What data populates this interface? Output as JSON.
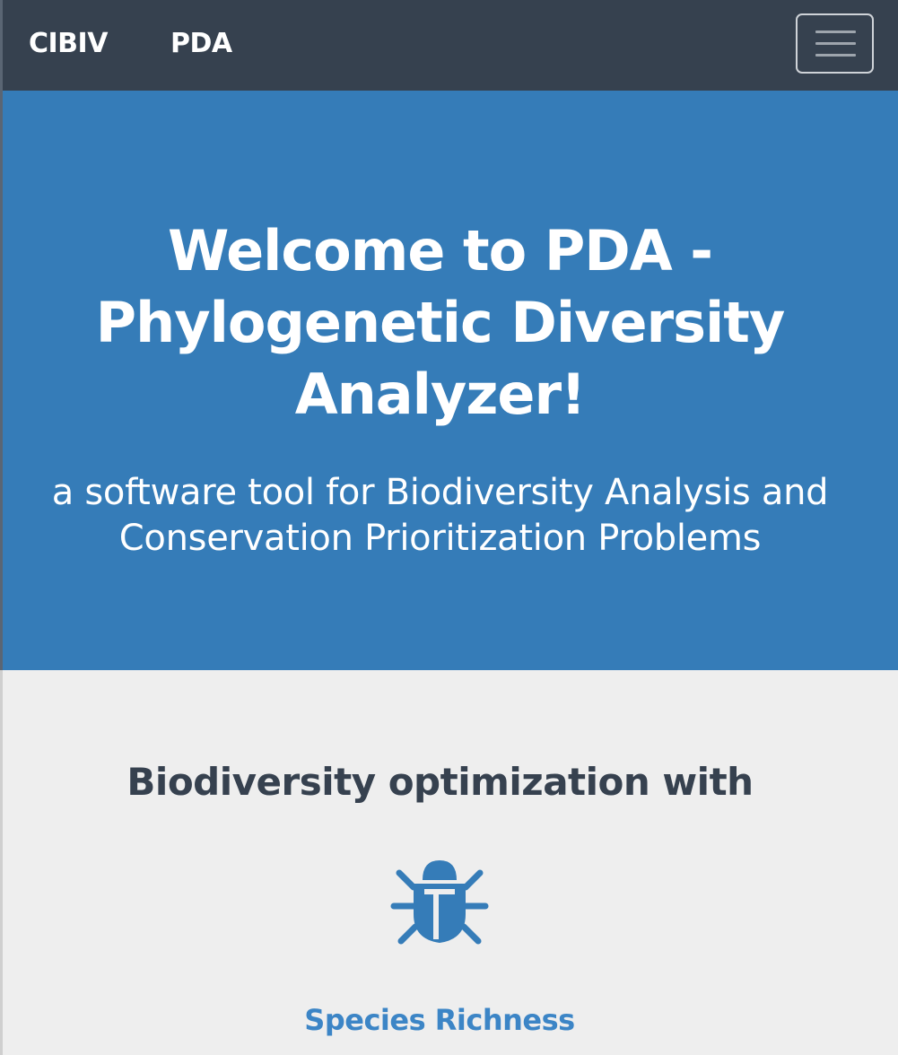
{
  "navbar": {
    "brand_primary": "CIBIV",
    "brand_secondary": "PDA",
    "toggle_icon": "hamburger-menu-icon",
    "background_color": "#36414f"
  },
  "hero": {
    "title": "Welcome to PDA - Phylogenetic Diversity Analyzer!",
    "subtitle": "a software tool for Biodiversity Analysis and Conservation Prioritization Problems",
    "background_color": "#357cb8"
  },
  "features": {
    "heading": "Biodiversity optimization with",
    "items": [
      {
        "icon": "bug-icon",
        "label": "Species Richness",
        "color": "#3c85c6"
      }
    ]
  }
}
